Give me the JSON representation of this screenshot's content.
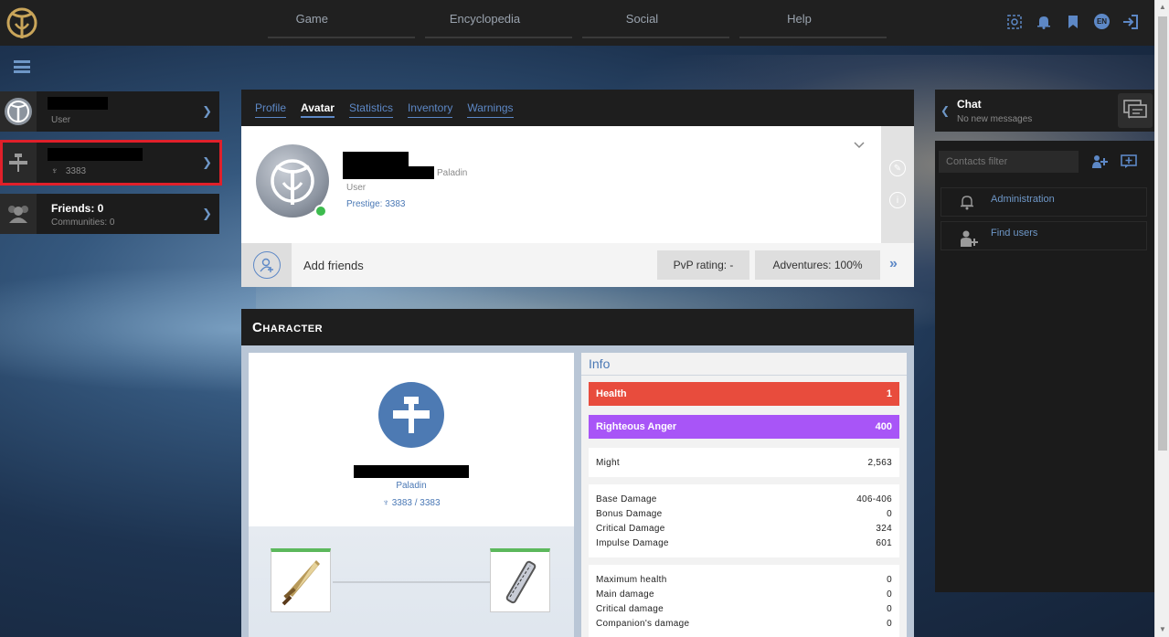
{
  "nav": {
    "items": [
      "Game",
      "Encyclopedia",
      "Social",
      "Help"
    ],
    "language_badge": "EN"
  },
  "left_panel": {
    "user_card": {
      "role": "User"
    },
    "character_card": {
      "prestige": "3383"
    },
    "friends_card": {
      "title": "Friends: 0",
      "communities": "Communities: 0"
    }
  },
  "profile": {
    "tabs": [
      "Profile",
      "Avatar",
      "Statistics",
      "Inventory",
      "Warnings"
    ],
    "active_tab": "Avatar",
    "class": "Paladin",
    "role": "User",
    "prestige": "Prestige: 3383",
    "add_friends": "Add friends",
    "pvp_rating": "PvP rating: -",
    "adventures": "Adventures: 100%"
  },
  "character": {
    "header": "Character",
    "class": "Paladin",
    "prestige": "3383 / 3383",
    "info_title": "Info",
    "health": {
      "label": "Health",
      "value": "1"
    },
    "anger": {
      "label": "Righteous Anger",
      "value": "400"
    },
    "might": {
      "label": "Might",
      "value": "2,563"
    },
    "damage": [
      {
        "label": "Base Damage",
        "value": "406-406"
      },
      {
        "label": "Bonus Damage",
        "value": "0"
      },
      {
        "label": "Critical Damage",
        "value": "324"
      },
      {
        "label": "Impulse Damage",
        "value": "601"
      }
    ],
    "bonuses": [
      {
        "label": "Maximum health",
        "value": "0"
      },
      {
        "label": "Main damage",
        "value": "0"
      },
      {
        "label": "Critical damage",
        "value": "0"
      },
      {
        "label": "Companion's damage",
        "value": "0"
      }
    ]
  },
  "chat": {
    "title": "Chat",
    "subtitle": "No new messages",
    "filter_placeholder": "Contacts filter",
    "items": [
      {
        "label": "Administration"
      },
      {
        "label": "Find users"
      }
    ]
  },
  "colors": {
    "accent": "#5d88c6",
    "health": "#e84c3d",
    "anger": "#a855f7",
    "online": "#3dbb4e",
    "highlight": "#e0202a"
  }
}
